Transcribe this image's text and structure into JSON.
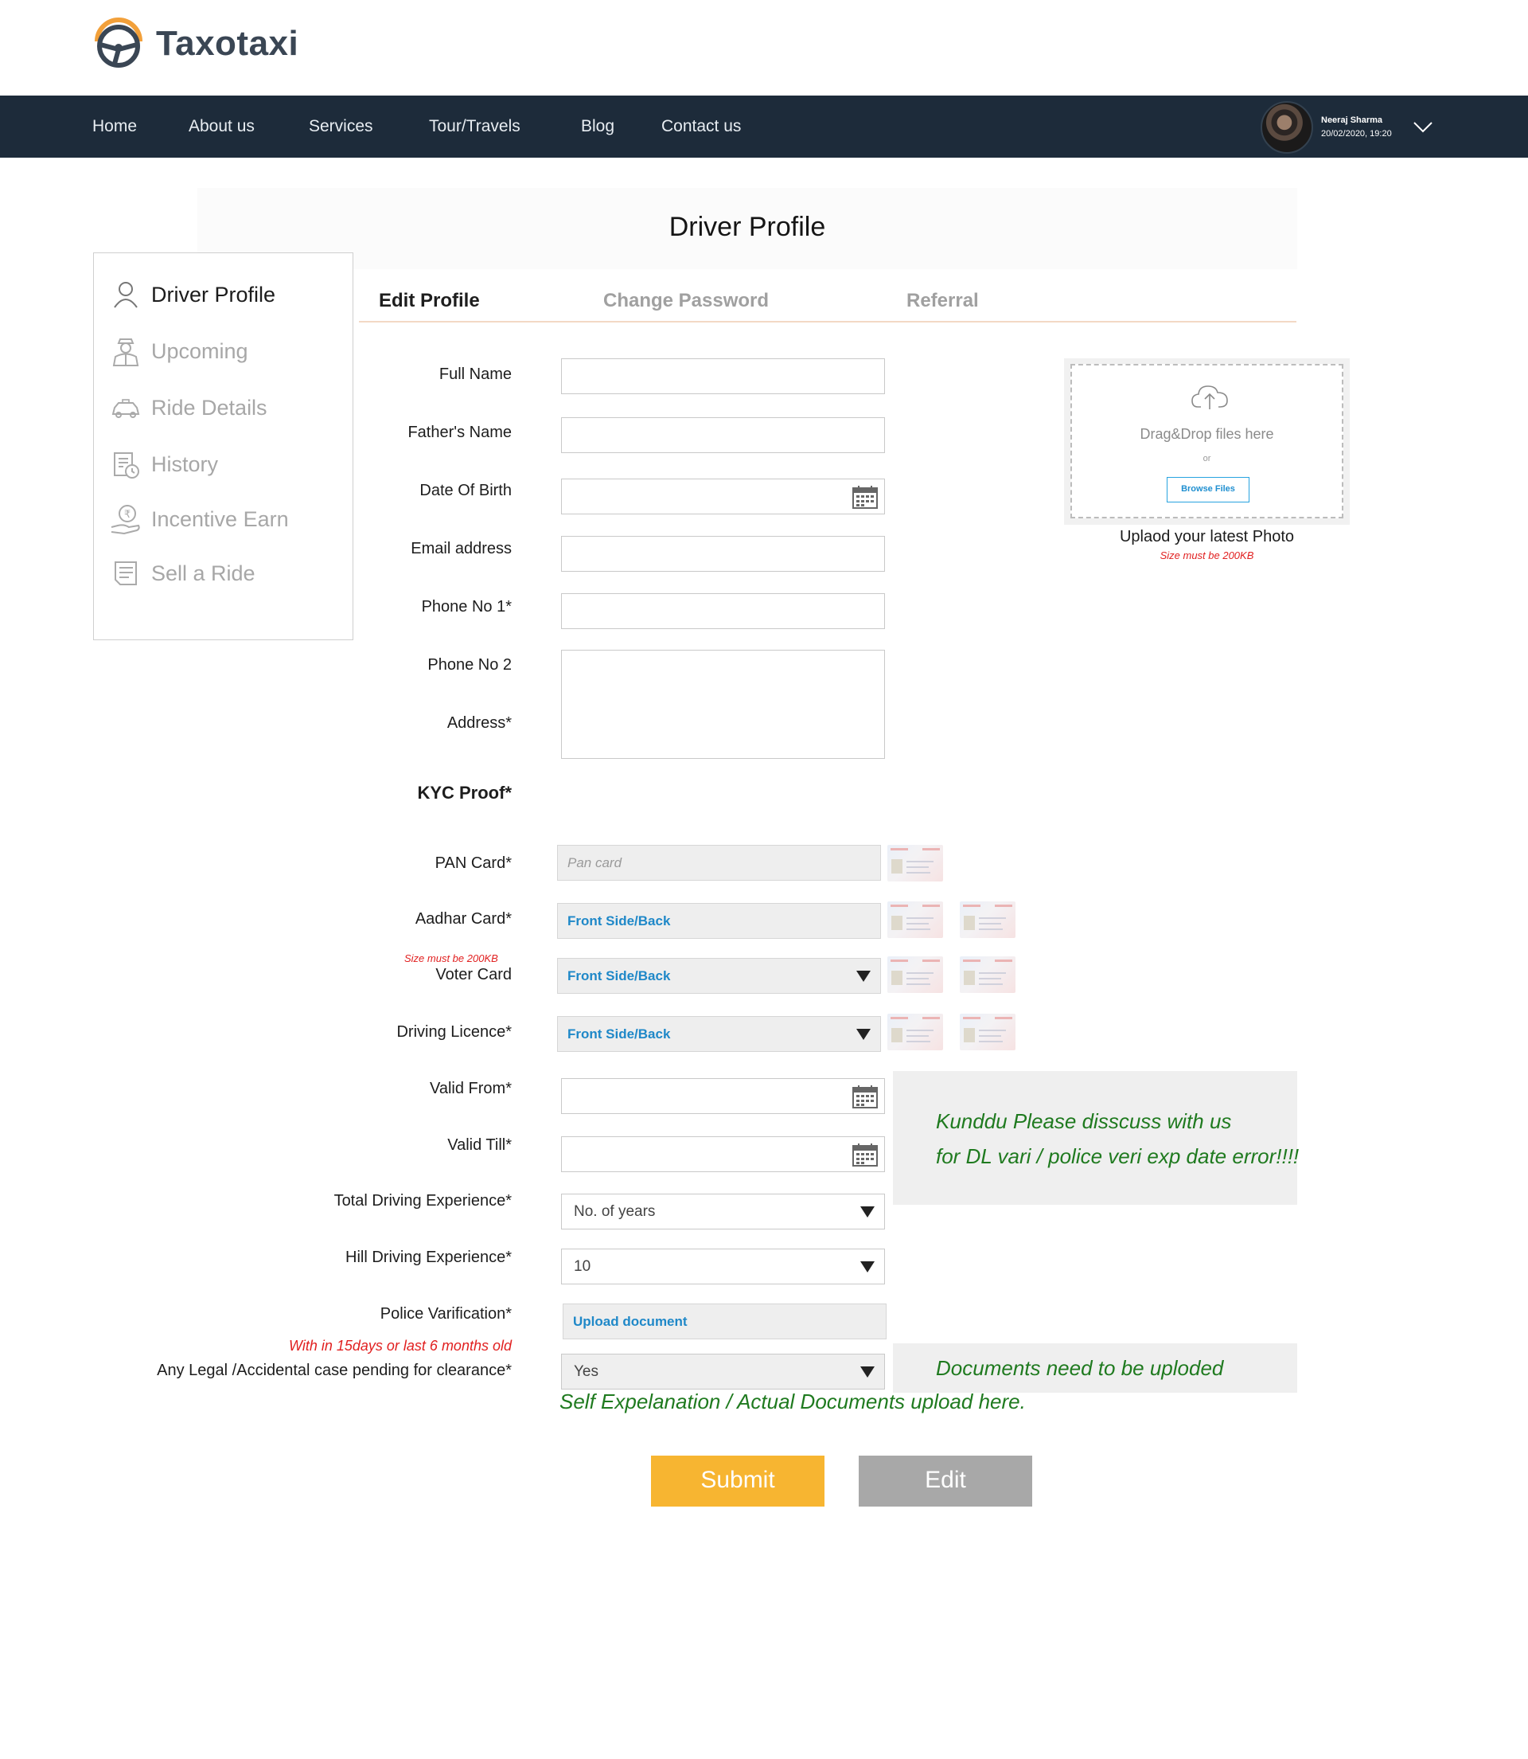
{
  "brand": {
    "name": "Taxotaxi"
  },
  "nav": {
    "items": [
      "Home",
      "About us",
      "Services",
      "Tour/Travels",
      "Blog",
      "Contact us"
    ],
    "user": {
      "name": "Neeraj Sharma",
      "datetime": "20/02/2020,  19:20"
    }
  },
  "page": {
    "title": "Driver Profile"
  },
  "sidebar": {
    "items": [
      {
        "label": "Driver Profile",
        "icon": "user-icon",
        "active": true
      },
      {
        "label": "Upcoming",
        "icon": "chauffeur-icon",
        "active": false
      },
      {
        "label": "Ride Details",
        "icon": "taxi-icon",
        "active": false
      },
      {
        "label": "History",
        "icon": "history-icon",
        "active": false
      },
      {
        "label": "Incentive Earn",
        "icon": "rupee-hand-icon",
        "active": false
      },
      {
        "label": "Sell a Ride",
        "icon": "list-icon",
        "active": false
      }
    ]
  },
  "tabs": [
    {
      "label": "Edit Profile",
      "active": true
    },
    {
      "label": "Change Password",
      "active": false
    },
    {
      "label": "Referral",
      "active": false
    }
  ],
  "form": {
    "full_name": {
      "label": "Full Name",
      "value": ""
    },
    "father_name": {
      "label": "Father's Name",
      "value": ""
    },
    "dob": {
      "label": "Date Of Birth",
      "value": ""
    },
    "email": {
      "label": "Email address",
      "value": ""
    },
    "phone1": {
      "label": "Phone No 1*",
      "value": ""
    },
    "phone2": {
      "label": "Phone No 2",
      "value": ""
    },
    "address": {
      "label": "Address*",
      "value": ""
    },
    "kyc": {
      "label": "KYC Proof*"
    },
    "pan": {
      "label": "PAN Card*",
      "placeholder": "Pan card"
    },
    "aadhar": {
      "label": "Aadhar Card*",
      "value": "Front Side/Back"
    },
    "size_note": "Size must be 200KB",
    "voter": {
      "label": "Voter Card",
      "value": "Front Side/Back"
    },
    "dl": {
      "label": "Driving Licence*",
      "value": "Front Side/Back"
    },
    "valid_from": {
      "label": "Valid From*",
      "value": ""
    },
    "valid_till": {
      "label": "Valid Till*",
      "value": ""
    },
    "total_exp": {
      "label": "Total Driving Experience*",
      "value": "No. of years"
    },
    "hill_exp": {
      "label": "Hill Driving Experience*",
      "value": "10"
    },
    "police": {
      "label": "Police Varification*",
      "value": "Upload document",
      "note": "With in 15days or last 6 months old"
    },
    "legal": {
      "label": "Any Legal /Accidental case pending for clearance*",
      "value": "Yes"
    }
  },
  "upload": {
    "drag_text": "Drag&Drop files here",
    "or_text": "or",
    "browse": "Browse Files",
    "caption": "Uplaod your latest Photo",
    "size_note": "Size must be 200KB"
  },
  "notes": {
    "dl_line1": "Kunddu Please disscuss with us",
    "dl_line2": "for DL vari / police veri exp date error!!!!",
    "docs": "Documents need to be uploded",
    "self_expl": "Self Expelanation / Actual Documents upload here."
  },
  "buttons": {
    "submit": "Submit",
    "edit": "Edit"
  },
  "colors": {
    "navbar": "#1d2b3a",
    "submit": "#f7b531",
    "edit": "#a8a8a8",
    "link_blue": "#1f88c8",
    "note_green": "#1f7a1f",
    "warning_red": "#e12020"
  }
}
